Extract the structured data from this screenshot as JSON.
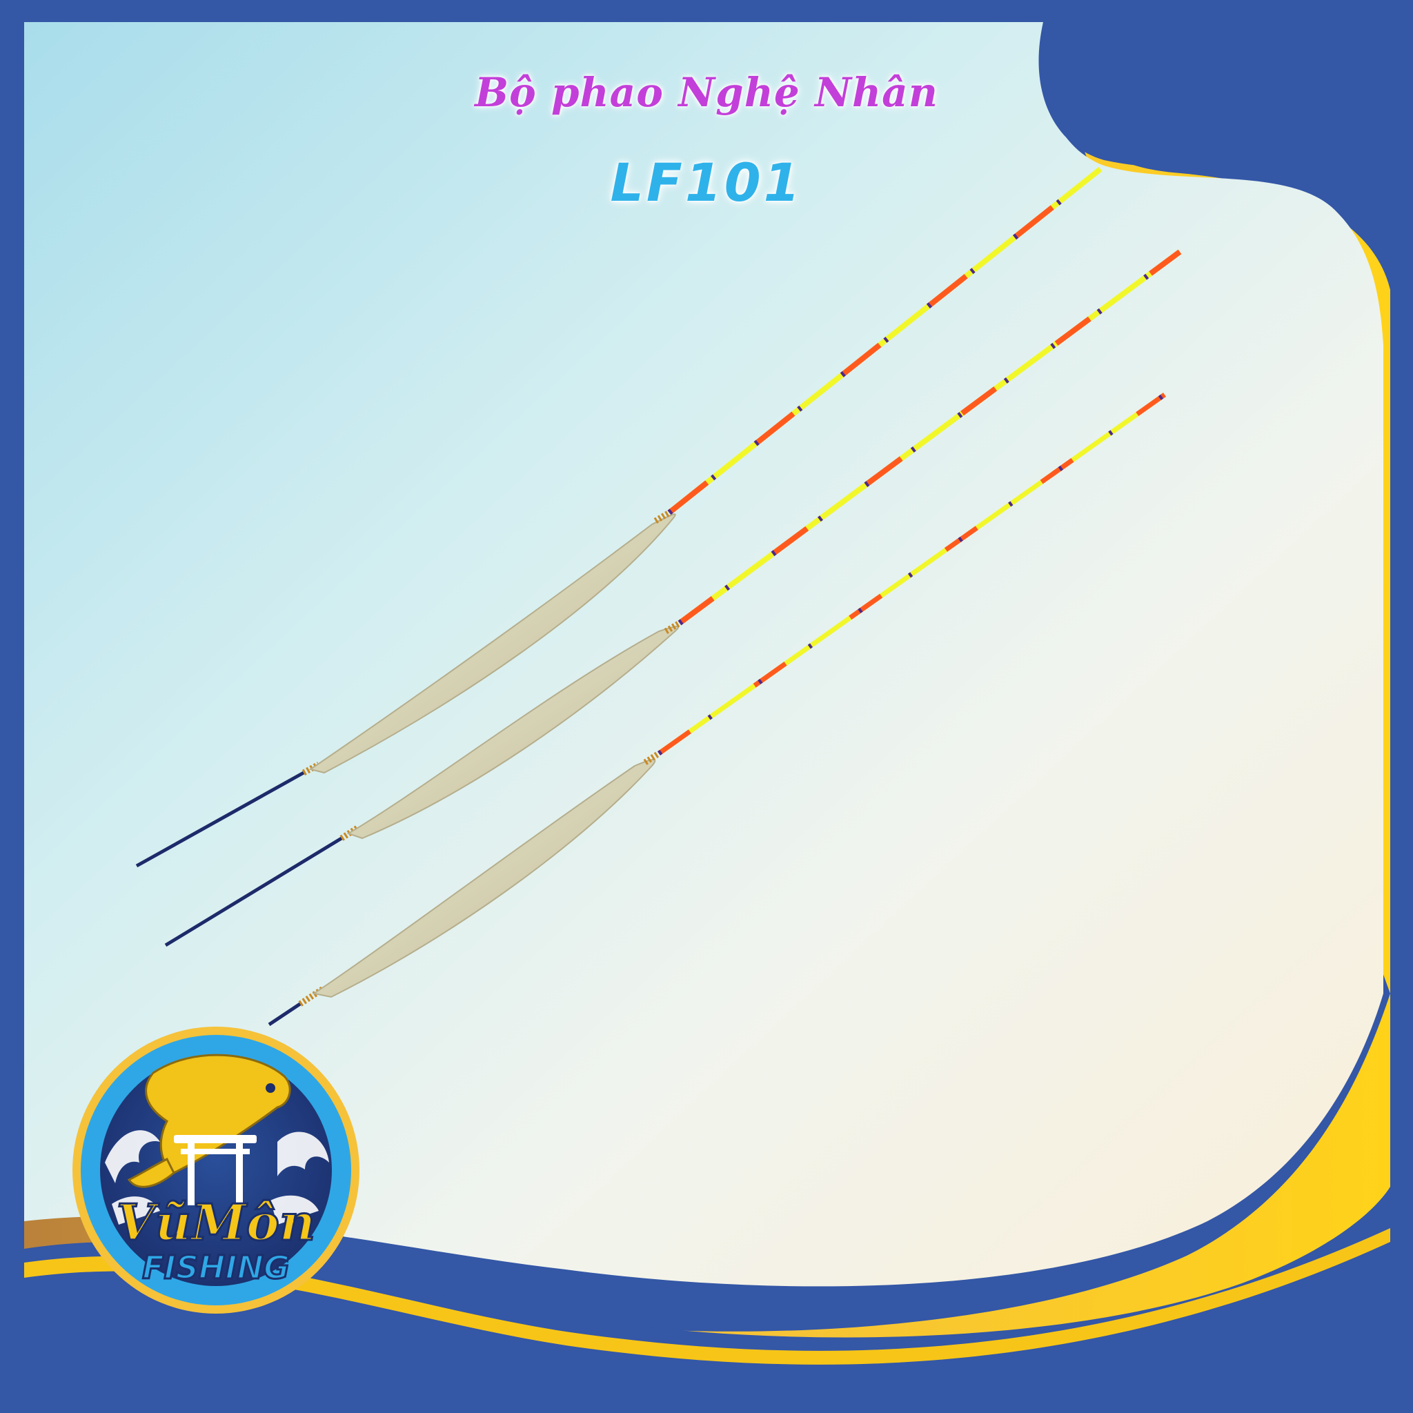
{
  "product": {
    "title": "Bộ phao Nghệ Nhân",
    "model": "LF101"
  },
  "brand": {
    "line1": "VũMôn",
    "line2": "FISHING",
    "logo_icon": "koi-fish-torii-gate-waves"
  },
  "colors": {
    "frame_blue": "#3457a6",
    "frame_gold": "#f7c518",
    "background_light": "#eaf4f3",
    "float_body": "#d8d4b8",
    "stem_yellow": "#f2f72a",
    "stem_orange": "#ff5a1e",
    "title_magenta": "#c33fd9",
    "model_cyan": "#2fb2ea"
  },
  "floats": [
    {
      "name": "float-1"
    },
    {
      "name": "float-2"
    },
    {
      "name": "float-3"
    }
  ]
}
